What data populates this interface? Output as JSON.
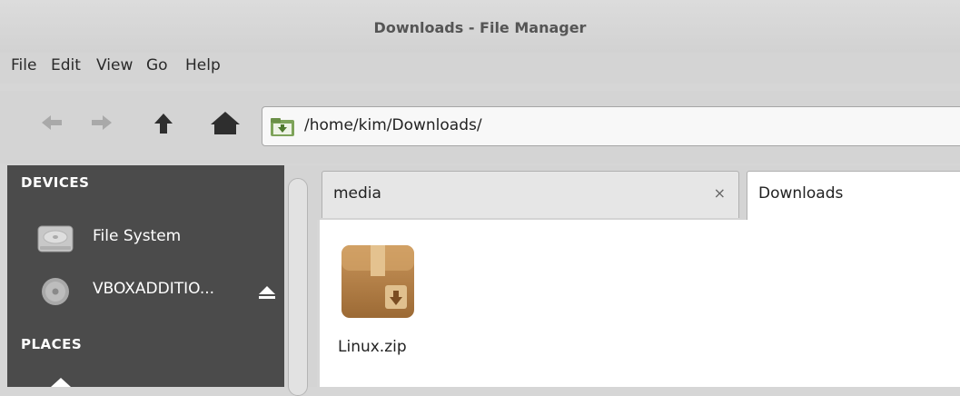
{
  "window": {
    "title": "Downloads - File Manager"
  },
  "menu": [
    "File",
    "Edit",
    "View",
    "Go",
    "Help"
  ],
  "toolbar": {
    "path": "/home/kim/Downloads/"
  },
  "sidebar": {
    "devices_header": "DEVICES",
    "devices": [
      {
        "label": "File System",
        "icon": "hard-drive-icon"
      },
      {
        "label": "VBOXADDITIO...",
        "icon": "optical-disc-icon"
      }
    ],
    "places_header": "PLACES"
  },
  "tabs": [
    {
      "label": "media",
      "close": "×"
    },
    {
      "label": "Downloads"
    }
  ],
  "files": [
    {
      "name": "Linux.zip",
      "icon": "archive-package-icon"
    }
  ]
}
